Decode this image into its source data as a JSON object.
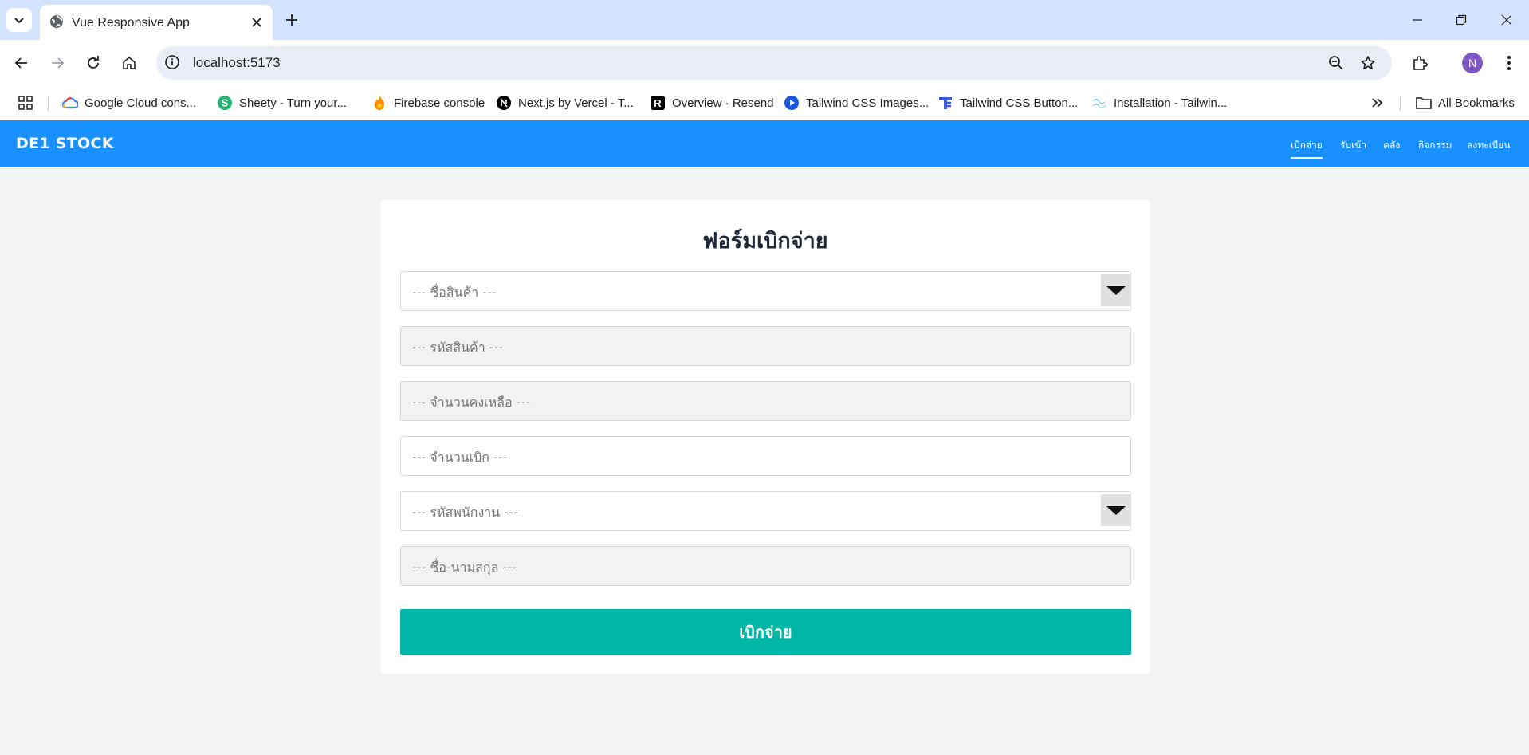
{
  "browser": {
    "tab_title": "Vue Responsive App",
    "url": "localhost:5173",
    "profile_initial": "N",
    "bookmarks": [
      {
        "label": "Google Cloud cons...",
        "icon": "google-cloud-icon"
      },
      {
        "label": "Sheety - Turn your...",
        "icon": "sheety-icon"
      },
      {
        "label": "Firebase console",
        "icon": "firebase-icon"
      },
      {
        "label": "Next.js by Vercel - T...",
        "icon": "nextjs-icon"
      },
      {
        "label": "Overview · Resend",
        "icon": "resend-icon"
      },
      {
        "label": "Tailwind CSS Images...",
        "icon": "play-icon"
      },
      {
        "label": "Tailwind CSS Button...",
        "icon": "tailwind-elements-icon"
      },
      {
        "label": "Installation - Tailwin...",
        "icon": "tailwind-icon"
      }
    ],
    "all_bookmarks_label": "All Bookmarks"
  },
  "app": {
    "brand": "DE1 STOCK",
    "nav": [
      {
        "label": "เบิกจ่าย",
        "active": true
      },
      {
        "label": "รับเข้า",
        "active": false
      },
      {
        "label": "คลัง",
        "active": false
      },
      {
        "label": "กิจกรรม",
        "active": false
      },
      {
        "label": "ลงทะเบียน",
        "active": false
      }
    ],
    "accent_color": "#1890ff",
    "submit_color": "#00b6a6"
  },
  "form": {
    "title": "ฟอร์มเบิกจ่าย",
    "product_name_placeholder": "--- ชื่อสินค้า ---",
    "product_code_placeholder": "--- รหัสสินค้า ---",
    "stock_remaining_placeholder": "--- จำนวนคงเหลือ ---",
    "withdraw_qty_placeholder": "--- จำนวนเบิก ---",
    "employee_id_placeholder": "--- รหัสพนักงาน ---",
    "employee_name_placeholder": "--- ชื่อ-นามสกุล ---",
    "submit_label": "เบิกจ่าย"
  }
}
